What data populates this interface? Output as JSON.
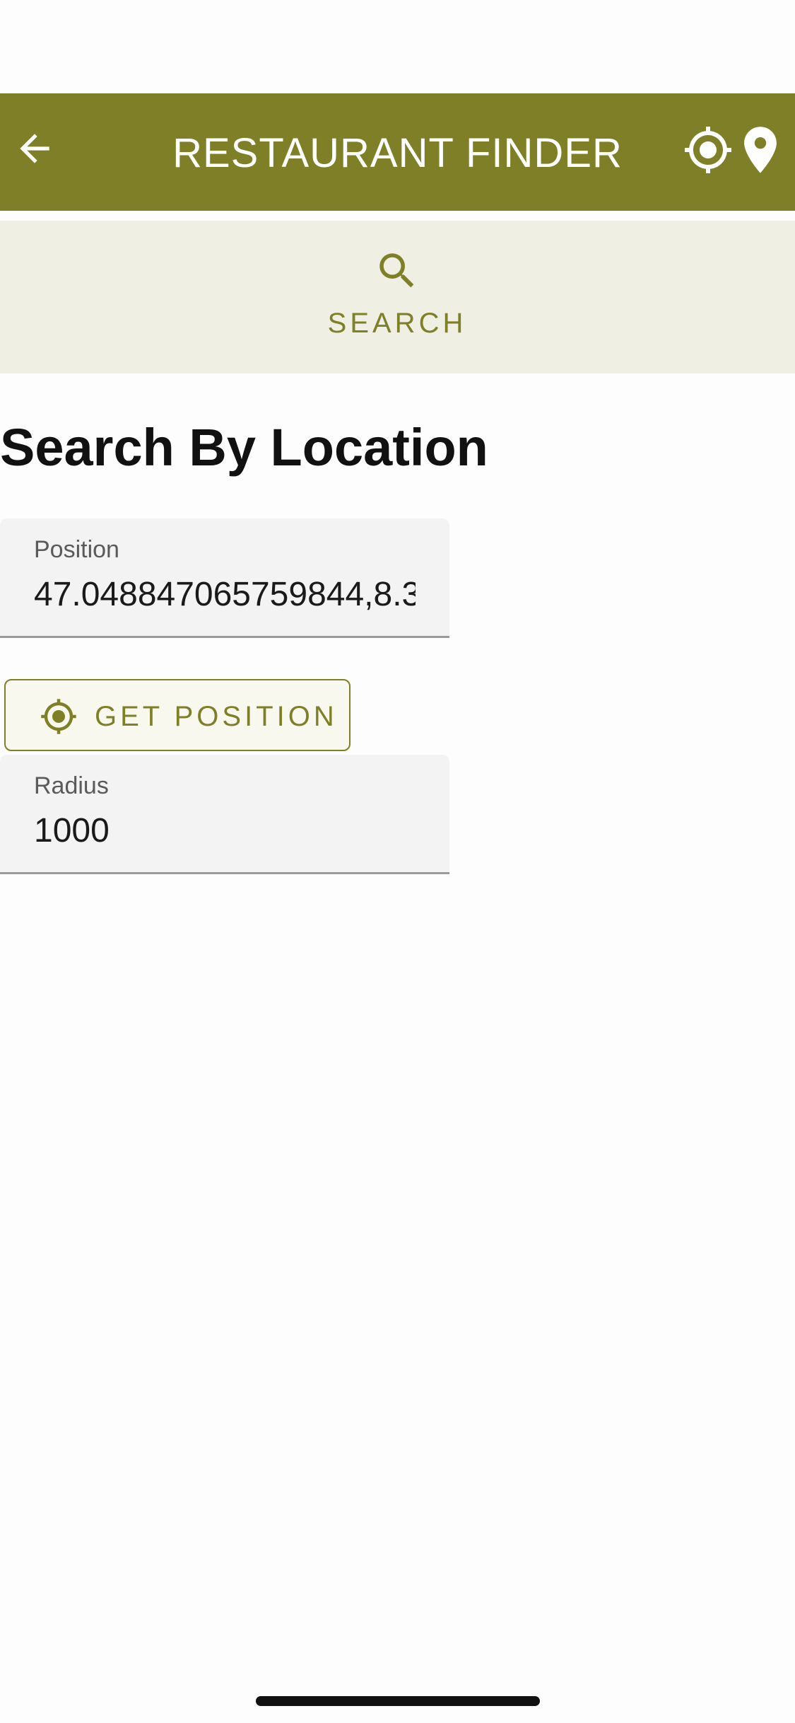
{
  "app_bar": {
    "title": "RESTAURANT FINDER",
    "background_color": "#7f7f27",
    "back_icon": "arrow-left-icon",
    "actions": [
      "crosshair-icon",
      "location-pin-icon"
    ]
  },
  "tabs": [
    {
      "label": "SEARCH",
      "icon": "search-icon",
      "selected": true
    }
  ],
  "page": {
    "heading": "Search By Location"
  },
  "form": {
    "position": {
      "label": "Position",
      "value": "47.048847065759844,8.3"
    },
    "get_position_button": {
      "label": "GET POSITION",
      "icon": "crosshair-icon"
    },
    "radius": {
      "label": "Radius",
      "value": "1000"
    }
  },
  "colors": {
    "accent": "#7f7f27",
    "tab_background": "#efefe3",
    "field_background": "#f3f3f3"
  }
}
